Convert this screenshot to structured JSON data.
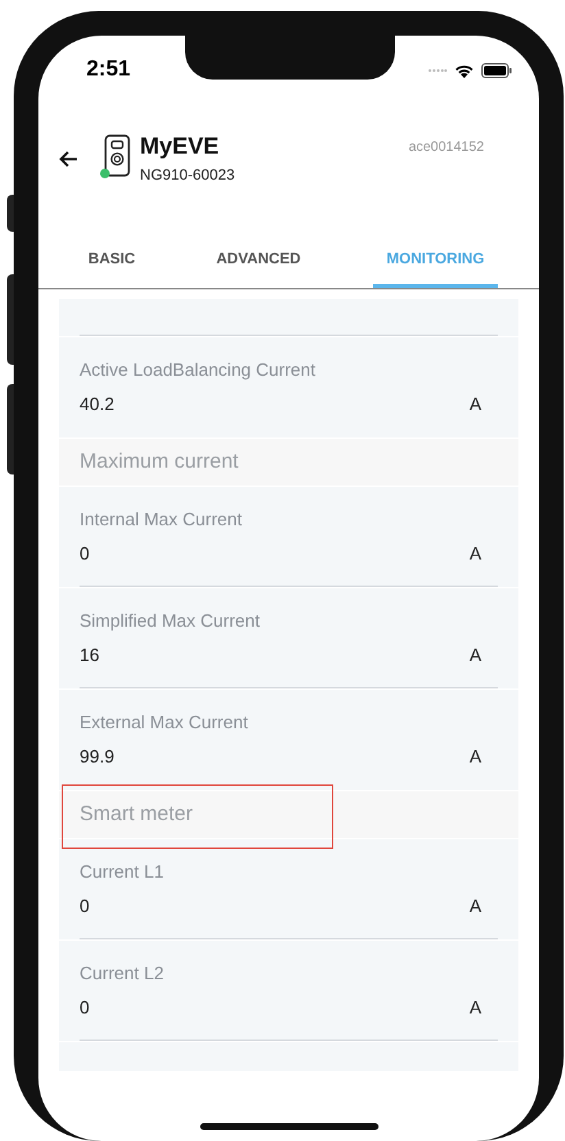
{
  "status_bar": {
    "time": "2:51"
  },
  "header": {
    "title": "MyEVE",
    "subtitle": "NG910-60023",
    "serial": "ace0014152",
    "online": true
  },
  "tabs": [
    {
      "label": "BASIC",
      "selected": false
    },
    {
      "label": "ADVANCED",
      "selected": false
    },
    {
      "label": "MONITORING",
      "selected": true
    }
  ],
  "items": [
    {
      "kind": "row",
      "label": "Active LoadBalancing Current",
      "value": "40.2",
      "unit": "A"
    },
    {
      "kind": "section",
      "label": "Maximum current",
      "highlighted": false
    },
    {
      "kind": "row",
      "label": "Internal Max Current",
      "value": "0",
      "unit": "A"
    },
    {
      "kind": "row",
      "label": "Simplified Max Current",
      "value": "16",
      "unit": "A"
    },
    {
      "kind": "row",
      "label": "External Max Current",
      "value": "99.9",
      "unit": "A"
    },
    {
      "kind": "section",
      "label": "Smart meter",
      "highlighted": true
    },
    {
      "kind": "row",
      "label": "Current L1",
      "value": "0",
      "unit": "A"
    },
    {
      "kind": "row",
      "label": "Current L2",
      "value": "0",
      "unit": "A"
    }
  ]
}
